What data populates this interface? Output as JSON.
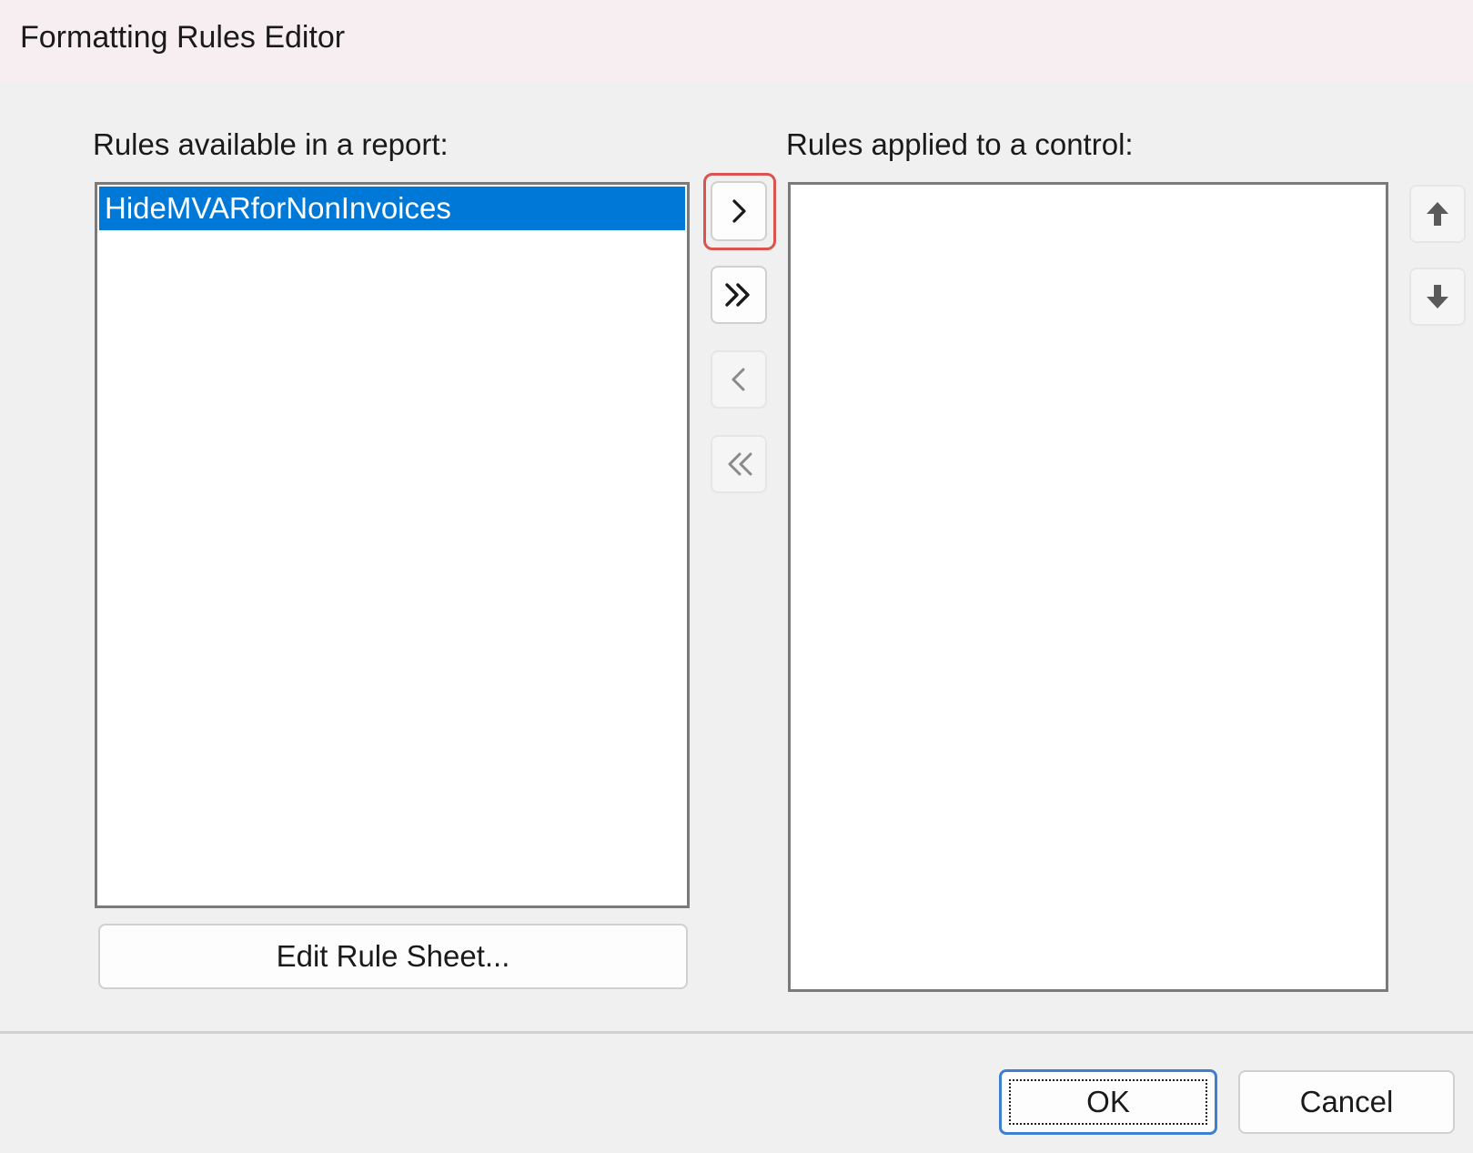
{
  "window": {
    "title": "Formatting Rules Editor"
  },
  "left_panel": {
    "label": "Rules available in a report:",
    "items": [
      {
        "label": "HideMVARforNonInvoices",
        "selected": true
      }
    ],
    "edit_button_label": "Edit Rule Sheet..."
  },
  "right_panel": {
    "label": "Rules applied to a control:",
    "items": []
  },
  "transfer_buttons": {
    "add_one": "chevron-right-icon",
    "add_all": "double-chevron-right-icon",
    "remove_one": "chevron-left-icon",
    "remove_all": "double-chevron-left-icon"
  },
  "order_buttons": {
    "move_up": "arrow-up-icon",
    "move_down": "arrow-down-icon"
  },
  "footer": {
    "ok_label": "OK",
    "cancel_label": "Cancel"
  },
  "colors": {
    "selection": "#0078d7",
    "highlight_outline": "#d9534f",
    "default_button_border": "#3f7fd0"
  }
}
